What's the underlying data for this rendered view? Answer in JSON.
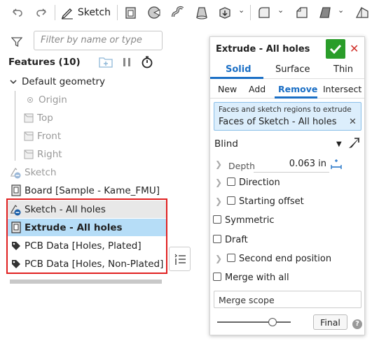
{
  "toolbar": {
    "sketch_label": "Sketch",
    "icons": [
      "undo-icon",
      "redo-icon",
      "sketch-pencil-icon",
      "extrude-icon",
      "revolve-icon",
      "sweep-icon",
      "loft-icon",
      "thicken-icon",
      "fillet-icon",
      "chamfer-icon",
      "draft-icon",
      "shell-icon"
    ]
  },
  "left": {
    "filter_placeholder": "Filter by name or type",
    "features_title": "Features (10)",
    "tree": [
      {
        "label": "Default geometry",
        "kind": "group"
      },
      {
        "label": "Origin",
        "kind": "origin"
      },
      {
        "label": "Top",
        "kind": "plane"
      },
      {
        "label": "Front",
        "kind": "plane"
      },
      {
        "label": "Right",
        "kind": "plane"
      },
      {
        "label": "Sketch",
        "kind": "sketch-muted"
      },
      {
        "label": "Board [Sample - Kame_FMU]",
        "kind": "part"
      },
      {
        "label": "Sketch - All holes",
        "kind": "sketch"
      },
      {
        "label": "Extrude - All holes",
        "kind": "extrude"
      },
      {
        "label": "PCB Data [Holes, Plated]",
        "kind": "tag"
      },
      {
        "label": "PCB Data [Holes, Non-Plated]",
        "kind": "tag"
      }
    ]
  },
  "dialog": {
    "title": "Extrude - All holes",
    "tabs1": [
      "Solid",
      "Surface",
      "Thin"
    ],
    "tabs1_active": "Solid",
    "tabs2": [
      "New",
      "Add",
      "Remove",
      "Intersect"
    ],
    "tabs2_active": "Remove",
    "faces_label": "Faces and sketch regions to extrude",
    "faces_value": "Faces of Sketch - All holes",
    "end_type": "Blind",
    "depth_label": "Depth",
    "depth_value": "0.063 in",
    "direction_label": "Direction",
    "starting_offset_label": "Starting offset",
    "symmetric_label": "Symmetric",
    "draft_label": "Draft",
    "second_end_label": "Second end position",
    "merge_all_label": "Merge with all",
    "merge_scope_label": "Merge scope",
    "final_label": "Final",
    "slider_fraction": 0.75
  },
  "colors": {
    "accent": "#1b6fc5",
    "ok_green": "#2a9d2a",
    "cancel_red": "#d0302a",
    "selection_blue": "#b6ddf7",
    "highlight_red": "#e02020"
  }
}
